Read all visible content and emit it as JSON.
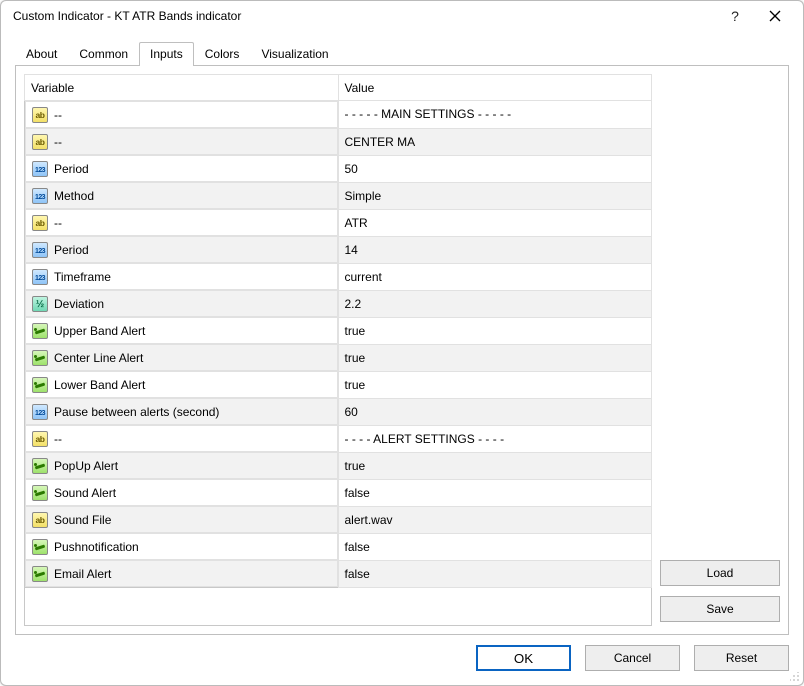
{
  "window": {
    "title": "Custom Indicator - KT ATR Bands indicator"
  },
  "tabs": {
    "about": "About",
    "common": "Common",
    "inputs": "Inputs",
    "colors": "Colors",
    "visualization": "Visualization",
    "active": "inputs"
  },
  "grid": {
    "headers": {
      "variable": "Variable",
      "value": "Value"
    },
    "rows": [
      {
        "icon": "ab",
        "name": "--",
        "value": "- - - - - MAIN SETTINGS - - - - -"
      },
      {
        "icon": "ab",
        "name": "--",
        "value": "CENTER MA"
      },
      {
        "icon": "123",
        "name": "Period",
        "value": "50"
      },
      {
        "icon": "123",
        "name": "Method",
        "value": "Simple"
      },
      {
        "icon": "ab",
        "name": "--",
        "value": "ATR"
      },
      {
        "icon": "123",
        "name": "Period",
        "value": "14"
      },
      {
        "icon": "123",
        "name": "Timeframe",
        "value": "current"
      },
      {
        "icon": "half",
        "name": "Deviation",
        "value": "2.2"
      },
      {
        "icon": "bool",
        "name": "Upper Band Alert",
        "value": "true"
      },
      {
        "icon": "bool",
        "name": "Center Line Alert",
        "value": "true"
      },
      {
        "icon": "bool",
        "name": "Lower Band Alert",
        "value": "true"
      },
      {
        "icon": "123",
        "name": "Pause between alerts (second)",
        "value": "60"
      },
      {
        "icon": "ab",
        "name": "--",
        "value": "- - - - ALERT SETTINGS - - - -"
      },
      {
        "icon": "bool",
        "name": "PopUp Alert",
        "value": "true"
      },
      {
        "icon": "bool",
        "name": "Sound Alert",
        "value": "false"
      },
      {
        "icon": "ab",
        "name": "Sound File",
        "value": "alert.wav"
      },
      {
        "icon": "bool",
        "name": "Pushnotification",
        "value": "false"
      },
      {
        "icon": "bool",
        "name": "Email Alert",
        "value": "false"
      }
    ]
  },
  "buttons": {
    "load": "Load",
    "save": "Save",
    "ok": "OK",
    "cancel": "Cancel",
    "reset": "Reset"
  }
}
